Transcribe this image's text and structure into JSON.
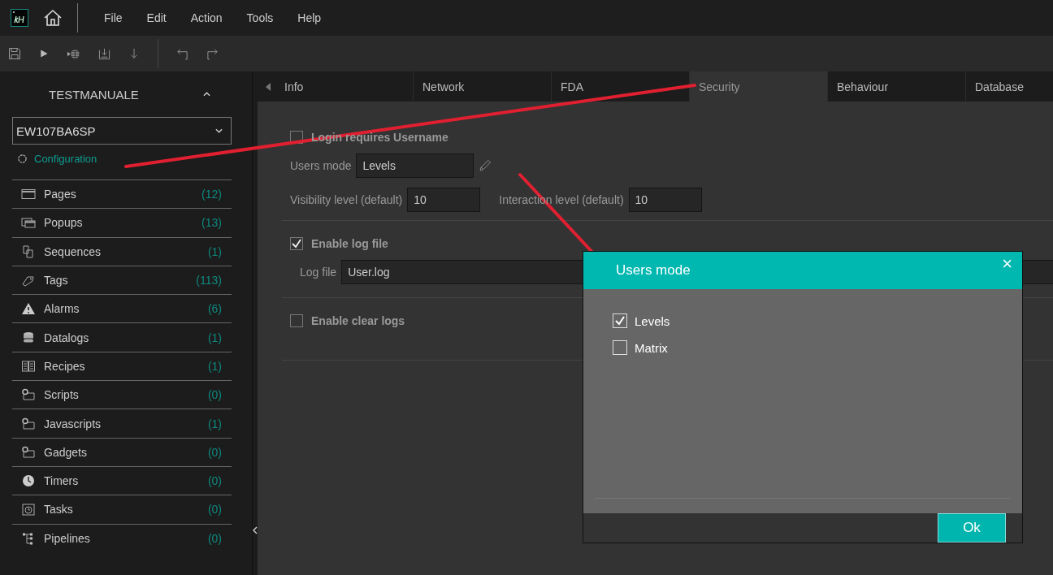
{
  "menu": [
    {
      "label": "File"
    },
    {
      "label": "Edit"
    },
    {
      "label": "Action"
    },
    {
      "label": "Tools"
    },
    {
      "label": "Help"
    }
  ],
  "sidebar": {
    "project": "TESTMANUALE",
    "device": "EW107BA6SP",
    "configuration": "Configuration",
    "items": [
      {
        "label": "Pages",
        "count": "(12)",
        "kind": "window"
      },
      {
        "label": "Popups",
        "count": "(13)",
        "kind": "popup"
      },
      {
        "label": "Sequences",
        "count": "(1)",
        "kind": "document"
      },
      {
        "label": "Tags",
        "count": "(113)",
        "kind": "tag"
      },
      {
        "label": "Alarms",
        "count": "(6)",
        "kind": "warning"
      },
      {
        "label": "Datalogs",
        "count": "(1)",
        "kind": "database"
      },
      {
        "label": "Recipes",
        "count": "(1)",
        "kind": "book"
      },
      {
        "label": "Scripts",
        "count": "(0)",
        "kind": "script"
      },
      {
        "label": "Javascripts",
        "count": "(1)",
        "kind": "script"
      },
      {
        "label": "Gadgets",
        "count": "(0)",
        "kind": "script"
      },
      {
        "label": "Timers",
        "count": "(0)",
        "kind": "clock"
      },
      {
        "label": "Tasks",
        "count": "(0)",
        "kind": "task"
      },
      {
        "label": "Pipelines",
        "count": "(0)",
        "kind": "tree"
      }
    ]
  },
  "tabs": [
    {
      "label": "Info",
      "selected": false
    },
    {
      "label": "Network",
      "selected": false
    },
    {
      "label": "FDA",
      "selected": false
    },
    {
      "label": "Security",
      "selected": true
    },
    {
      "label": "Behaviour",
      "selected": false
    },
    {
      "label": "Database",
      "selected": false
    }
  ],
  "security": {
    "login_requires_username": {
      "label": "Login requires Username",
      "checked": false
    },
    "users_mode": {
      "label": "Users mode",
      "value": "Levels"
    },
    "visibility_level": {
      "label": "Visibility level (default)",
      "value": "10"
    },
    "interaction_level": {
      "label": "Interaction level (default)",
      "value": "10"
    },
    "enable_log_file": {
      "label": "Enable log file",
      "checked": true
    },
    "log_file": {
      "label": "Log file",
      "value": "User.log"
    },
    "enable_clear_logs": {
      "label": "Enable clear logs",
      "checked": false
    }
  },
  "dialog": {
    "title": "Users mode",
    "close": "×",
    "options": [
      {
        "label": "Levels",
        "checked": true
      },
      {
        "label": "Matrix",
        "checked": false
      }
    ],
    "ok": "Ok"
  }
}
